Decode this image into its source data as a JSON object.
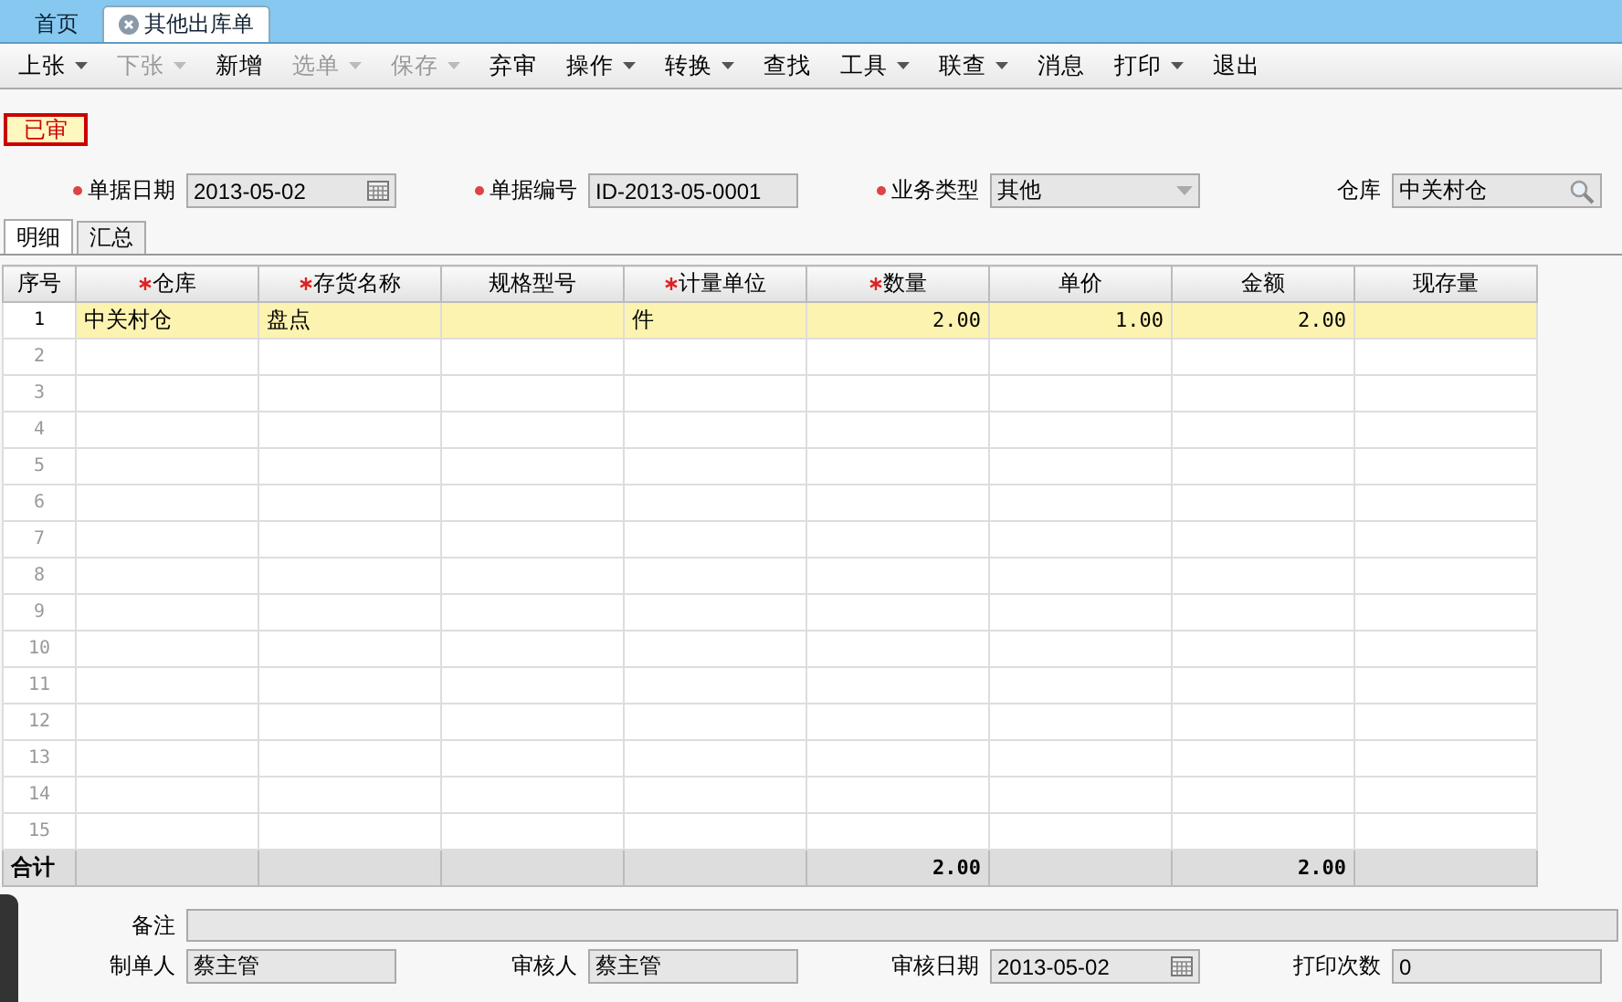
{
  "tabs": [
    {
      "label": "首页",
      "selected": false,
      "closable": false
    },
    {
      "label": "其他出库单",
      "selected": true,
      "closable": true
    }
  ],
  "toolbar": [
    {
      "label": "上张",
      "disabled": false,
      "dropdown": true
    },
    {
      "label": "下张",
      "disabled": true,
      "dropdown": true
    },
    {
      "label": "新增",
      "disabled": false,
      "dropdown": false
    },
    {
      "label": "选单",
      "disabled": true,
      "dropdown": true
    },
    {
      "label": "保存",
      "disabled": true,
      "dropdown": true
    },
    {
      "label": "弃审",
      "disabled": false,
      "dropdown": false
    },
    {
      "label": "操作",
      "disabled": false,
      "dropdown": true
    },
    {
      "label": "转换",
      "disabled": false,
      "dropdown": true
    },
    {
      "label": "查找",
      "disabled": false,
      "dropdown": false
    },
    {
      "label": "工具",
      "disabled": false,
      "dropdown": true
    },
    {
      "label": "联查",
      "disabled": false,
      "dropdown": true
    },
    {
      "label": "消息",
      "disabled": false,
      "dropdown": false
    },
    {
      "label": "打印",
      "disabled": false,
      "dropdown": true
    },
    {
      "label": "退出",
      "disabled": false,
      "dropdown": false
    }
  ],
  "status_stamp": "已审",
  "header_fields": [
    {
      "label": "单据日期",
      "value": "2013-05-02",
      "required": true,
      "kind": "date"
    },
    {
      "label": "单据编号",
      "value": "ID-2013-05-0001",
      "required": true,
      "kind": "text"
    },
    {
      "label": "业务类型",
      "value": "其他",
      "required": true,
      "kind": "select"
    },
    {
      "label": "仓库",
      "value": "中关村仓",
      "required": false,
      "kind": "lookup"
    }
  ],
  "sub_tabs": [
    {
      "label": "明细",
      "selected": true
    },
    {
      "label": "汇总",
      "selected": false
    }
  ],
  "table": {
    "columns": [
      {
        "label": "序号",
        "required": false
      },
      {
        "label": "仓库",
        "required": true
      },
      {
        "label": "存货名称",
        "required": true
      },
      {
        "label": "规格型号",
        "required": false
      },
      {
        "label": "计量单位",
        "required": true
      },
      {
        "label": "数量",
        "required": true
      },
      {
        "label": "单价",
        "required": false
      },
      {
        "label": "金额",
        "required": false
      },
      {
        "label": "现存量",
        "required": false
      }
    ],
    "rows": [
      {
        "selected": true,
        "no": "1",
        "warehouse": "中关村仓",
        "item_name": "盘点",
        "unit": "件",
        "quantity": "2.00",
        "unit_price": "1.00",
        "amount": "2.00"
      },
      {
        "selected": false,
        "no": "2"
      },
      {
        "selected": false,
        "no": "3"
      },
      {
        "selected": false,
        "no": "4"
      },
      {
        "selected": false,
        "no": "5"
      },
      {
        "selected": false,
        "no": "6"
      },
      {
        "selected": false,
        "no": "7"
      },
      {
        "selected": false,
        "no": "8"
      },
      {
        "selected": false,
        "no": "9"
      },
      {
        "selected": false,
        "no": "10"
      },
      {
        "selected": false,
        "no": "11"
      },
      {
        "selected": false,
        "no": "12"
      },
      {
        "selected": false,
        "no": "13"
      },
      {
        "selected": false,
        "no": "14"
      },
      {
        "selected": false,
        "no": "15"
      }
    ],
    "totals": {
      "no": "合计",
      "quantity": "2.00",
      "amount": "2.00"
    }
  },
  "remark": {
    "label": "备注"
  },
  "footer_fields": [
    {
      "label": "制单人",
      "value": "蔡主管",
      "kind": "text"
    },
    {
      "label": "审核人",
      "value": "蔡主管",
      "kind": "text"
    },
    {
      "label": "审核日期",
      "value": "2013-05-02",
      "kind": "date"
    },
    {
      "label": "打印次数",
      "value": "0",
      "kind": "text"
    }
  ]
}
